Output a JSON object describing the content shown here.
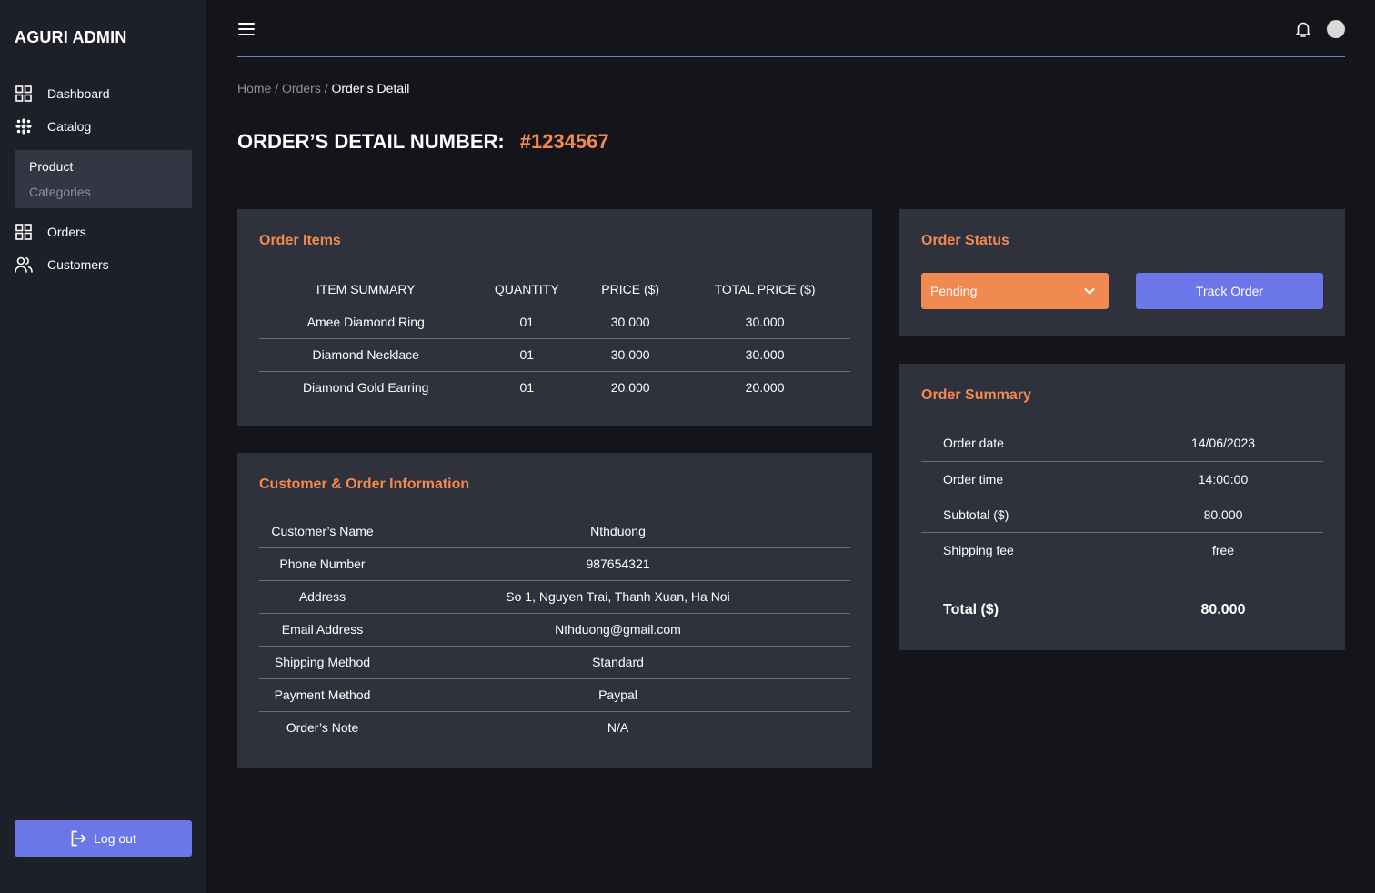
{
  "sidebar": {
    "brand": "AGURI ADMIN",
    "items": [
      {
        "label": "Dashboard"
      },
      {
        "label": "Catalog"
      },
      {
        "label": "Orders"
      },
      {
        "label": "Customers"
      }
    ],
    "submenu": [
      "Product",
      "Categories"
    ],
    "logout_label": "Log out"
  },
  "breadcrumb": {
    "home": "Home",
    "orders": "Orders",
    "current": "Order’s Detail",
    "separator": "/"
  },
  "page": {
    "title": "ORDER’S DETAIL NUMBER:",
    "order_number": "#1234567"
  },
  "order_items": {
    "title": "Order Items",
    "headers": [
      "ITEM SUMMARY",
      "QUANTITY",
      "PRICE ($)",
      "TOTAL PRICE ($)"
    ],
    "rows": [
      [
        "Amee Diamond Ring",
        "01",
        "30.000",
        "30.000"
      ],
      [
        "Diamond Necklace",
        "01",
        "30.000",
        "30.000"
      ],
      [
        "Diamond Gold Earring",
        "01",
        "20.000",
        "20.000"
      ]
    ]
  },
  "customer_info": {
    "title": "Customer & Order Information",
    "rows": [
      [
        "Customer’s Name",
        "Nthduong"
      ],
      [
        "Phone Number",
        "987654321"
      ],
      [
        "Address",
        "So 1, Nguyen Trai, Thanh Xuan, Ha Noi"
      ],
      [
        "Email Address",
        "Nthduong@gmail.com"
      ],
      [
        "Shipping Method",
        "Standard"
      ],
      [
        "Payment Method",
        "Paypal"
      ],
      [
        "Order’s Note",
        "N/A"
      ]
    ]
  },
  "order_status": {
    "title": "Order Status",
    "selected": "Pending",
    "track_label": "Track Order"
  },
  "order_summary": {
    "title": "Order Summary",
    "rows": [
      [
        "Order date",
        "14/06/2023"
      ],
      [
        "Order time",
        "14:00:00"
      ],
      [
        "Subtotal ($)",
        "80.000"
      ],
      [
        "Shipping fee",
        "free"
      ]
    ],
    "total_label": "Total ($)",
    "total_value": "80.000"
  },
  "colors": {
    "accent": "#f08a50",
    "primary": "#6b77e8",
    "background": "#14151a",
    "sidebar": "#1e2029",
    "card": "#2f313c"
  }
}
